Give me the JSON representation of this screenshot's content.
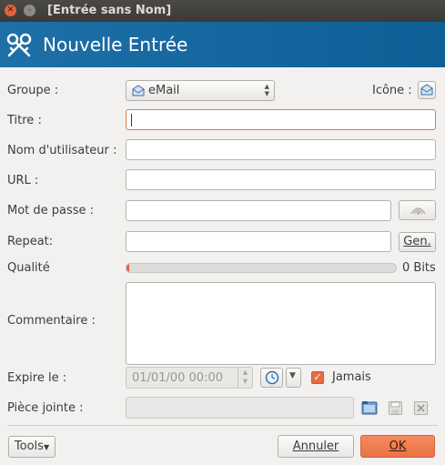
{
  "window": {
    "title": "[Entrée sans Nom]"
  },
  "header": {
    "title": "Nouvelle Entrée"
  },
  "form": {
    "group_label": "Groupe :",
    "group_value": "eMail",
    "icon_label": "Icône :",
    "title_label": "Titre :",
    "title_value": "",
    "username_label": "Nom d'utilisateur :",
    "username_value": "",
    "url_label": "URL :",
    "url_value": "",
    "password_label": "Mot de passe :",
    "password_value": "",
    "repeat_label": "Repeat:",
    "repeat_value": "",
    "gen_button": "Gen.",
    "quality_label": "Qualité",
    "quality_bits": "0 Bits",
    "quality_fraction": 0.01,
    "comment_label": "Commentaire :",
    "expires_label": "Expire le :",
    "expires_value": "01/01/00 00:00",
    "never_label": "Jamais",
    "never_checked": true,
    "attachment_label": "Pièce jointe :"
  },
  "footer": {
    "tools_button": "Tools",
    "cancel_button": "Annuler",
    "ok_button": "OK"
  },
  "colors": {
    "accent": "#e56d3f",
    "header": "#1a6aa2"
  }
}
